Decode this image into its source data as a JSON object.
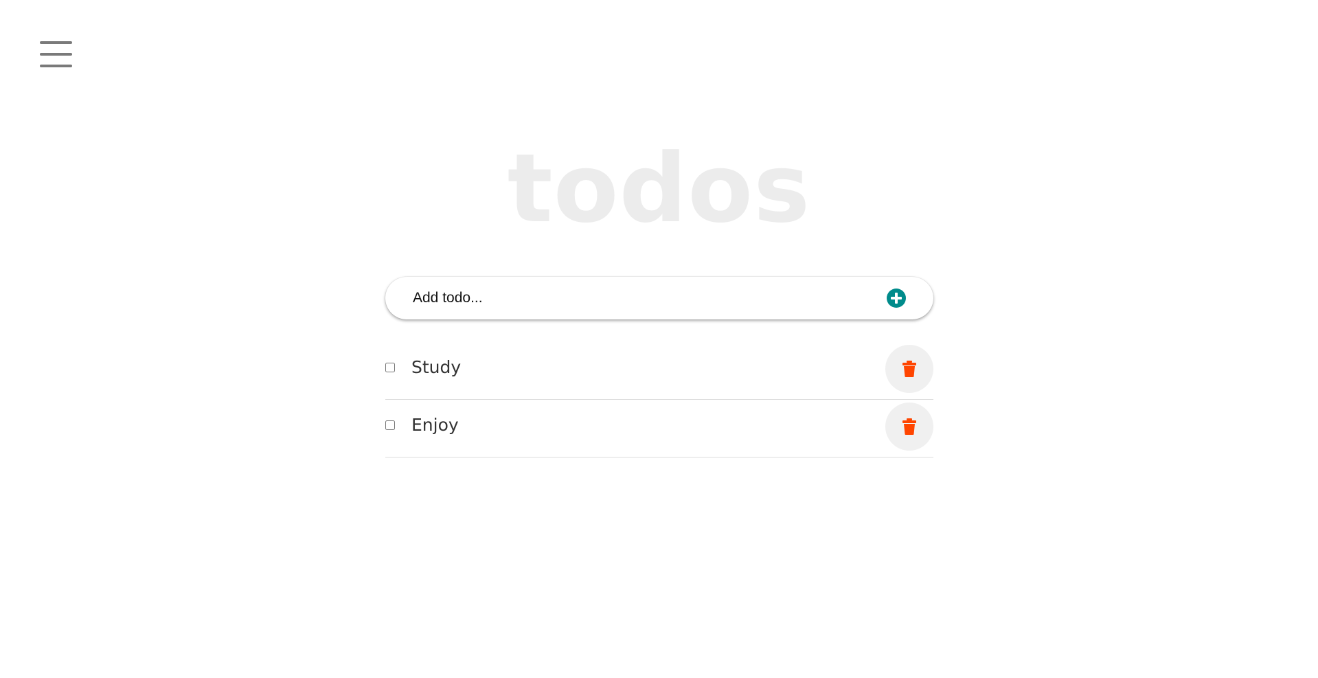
{
  "app": {
    "title": "todos"
  },
  "add_bar": {
    "placeholder": "Add todo...",
    "add_icon": "plus-circle-icon",
    "accent_color": "#008b8b"
  },
  "menu": {
    "icon": "hamburger-menu-icon"
  },
  "todos": [
    {
      "label": "Study",
      "checked": false
    },
    {
      "label": "Enjoy",
      "checked": false
    }
  ],
  "colors": {
    "delete_icon": "#ff4500",
    "delete_button_bg": "#f0f0f0",
    "title": "#ececec"
  }
}
